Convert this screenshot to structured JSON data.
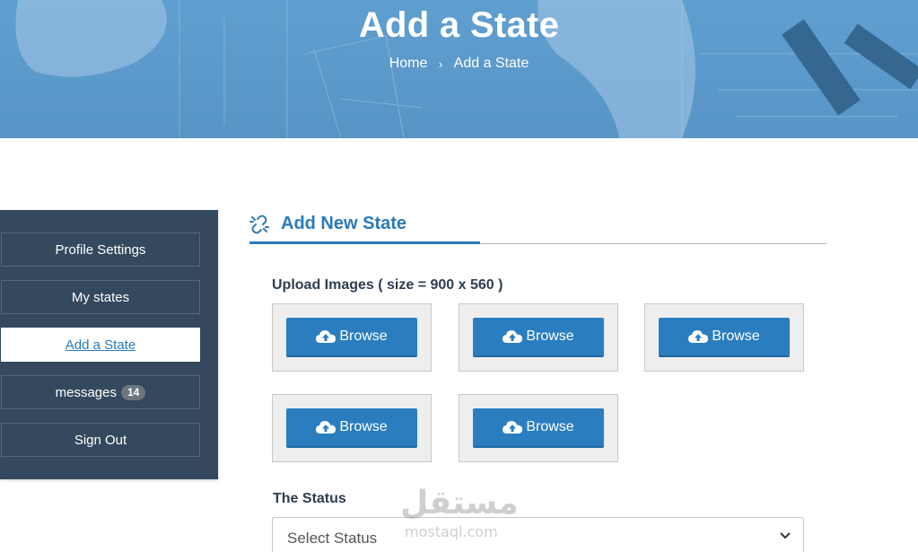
{
  "hero": {
    "title": "Add a State",
    "breadcrumb": {
      "home": "Home",
      "separator": "›",
      "current": "Add a State"
    }
  },
  "sidebar": {
    "items": [
      {
        "label": "Profile Settings"
      },
      {
        "label": "My states"
      },
      {
        "label": "Add a State",
        "active": true
      },
      {
        "label": "messages",
        "badge": "14"
      },
      {
        "label": "Sign Out"
      }
    ]
  },
  "main": {
    "section_title": "Add New State",
    "upload_label": "Upload Images ( size = 900 x 560 )",
    "browse_label": "Browse",
    "status_label": "The Status",
    "status_select": {
      "selected": "Select Status"
    }
  },
  "watermark": {
    "arabic": "مستقل",
    "latin": "mostaql.com"
  },
  "colors": {
    "accent": "#2a7ab9",
    "button": "#2a7ec0",
    "sidebar_bg": "#34495e",
    "hero_bg": "#5894c6"
  }
}
